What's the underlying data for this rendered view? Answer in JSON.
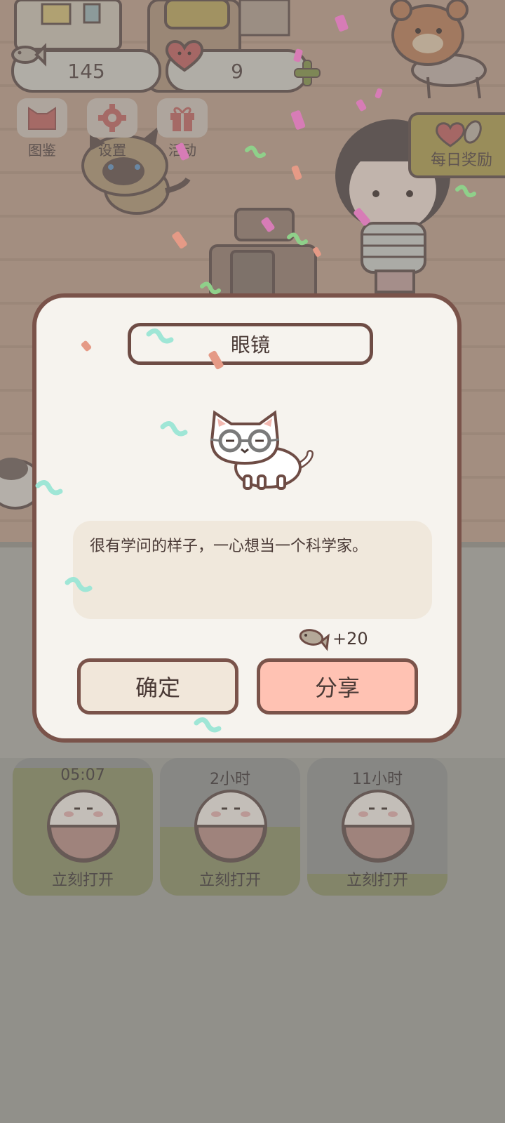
{
  "currency": {
    "fish": "145",
    "hearts": "9"
  },
  "menu": [
    {
      "label": "图鉴",
      "icon": "cat-head-icon"
    },
    {
      "label": "设置",
      "icon": "gear-icon"
    },
    {
      "label": "活动",
      "icon": "gift-icon"
    }
  ],
  "daily_reward": {
    "label": "每日奖励"
  },
  "dialog": {
    "title": "眼镜",
    "description": "很有学问的样子，一心想当一个科学家。",
    "reward": "+20",
    "confirm_label": "确定",
    "share_label": "分享"
  },
  "slots": [
    {
      "timer": "05:07",
      "open_label": "立刻打开",
      "progress": 0.93
    },
    {
      "timer": "2小时",
      "open_label": "立刻打开",
      "progress": 0.5
    },
    {
      "timer": "11小时",
      "open_label": "立刻打开",
      "progress": 0.16
    }
  ],
  "colors": {
    "dialog_border": "#7a534a",
    "share_button": "#ffc2b3",
    "confirm_button": "#f1e7da",
    "slot_fill": "#84875c"
  }
}
